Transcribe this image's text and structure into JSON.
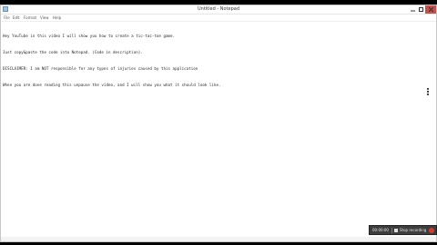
{
  "window": {
    "title": "Untitled - Notepad"
  },
  "menu": {
    "items": [
      "File",
      "Edit",
      "Format",
      "View",
      "Help"
    ]
  },
  "editor": {
    "lines": [
      "Hey YouTube in this video I will show you how to create a tic-tac-toe game.",
      "Just copy&paste the code into Notepad. (Code in description).",
      "DISCLAIMER: I am NOT responsible for any types of injuries caused by this application",
      "When you are done reading this unpause the video, and I will show you what it should look like."
    ]
  },
  "recorder": {
    "time": "00:00:00",
    "stop_label": "Stop recording"
  },
  "colors": {
    "close_button": "#c7504a",
    "record_red": "#d83b2d"
  }
}
